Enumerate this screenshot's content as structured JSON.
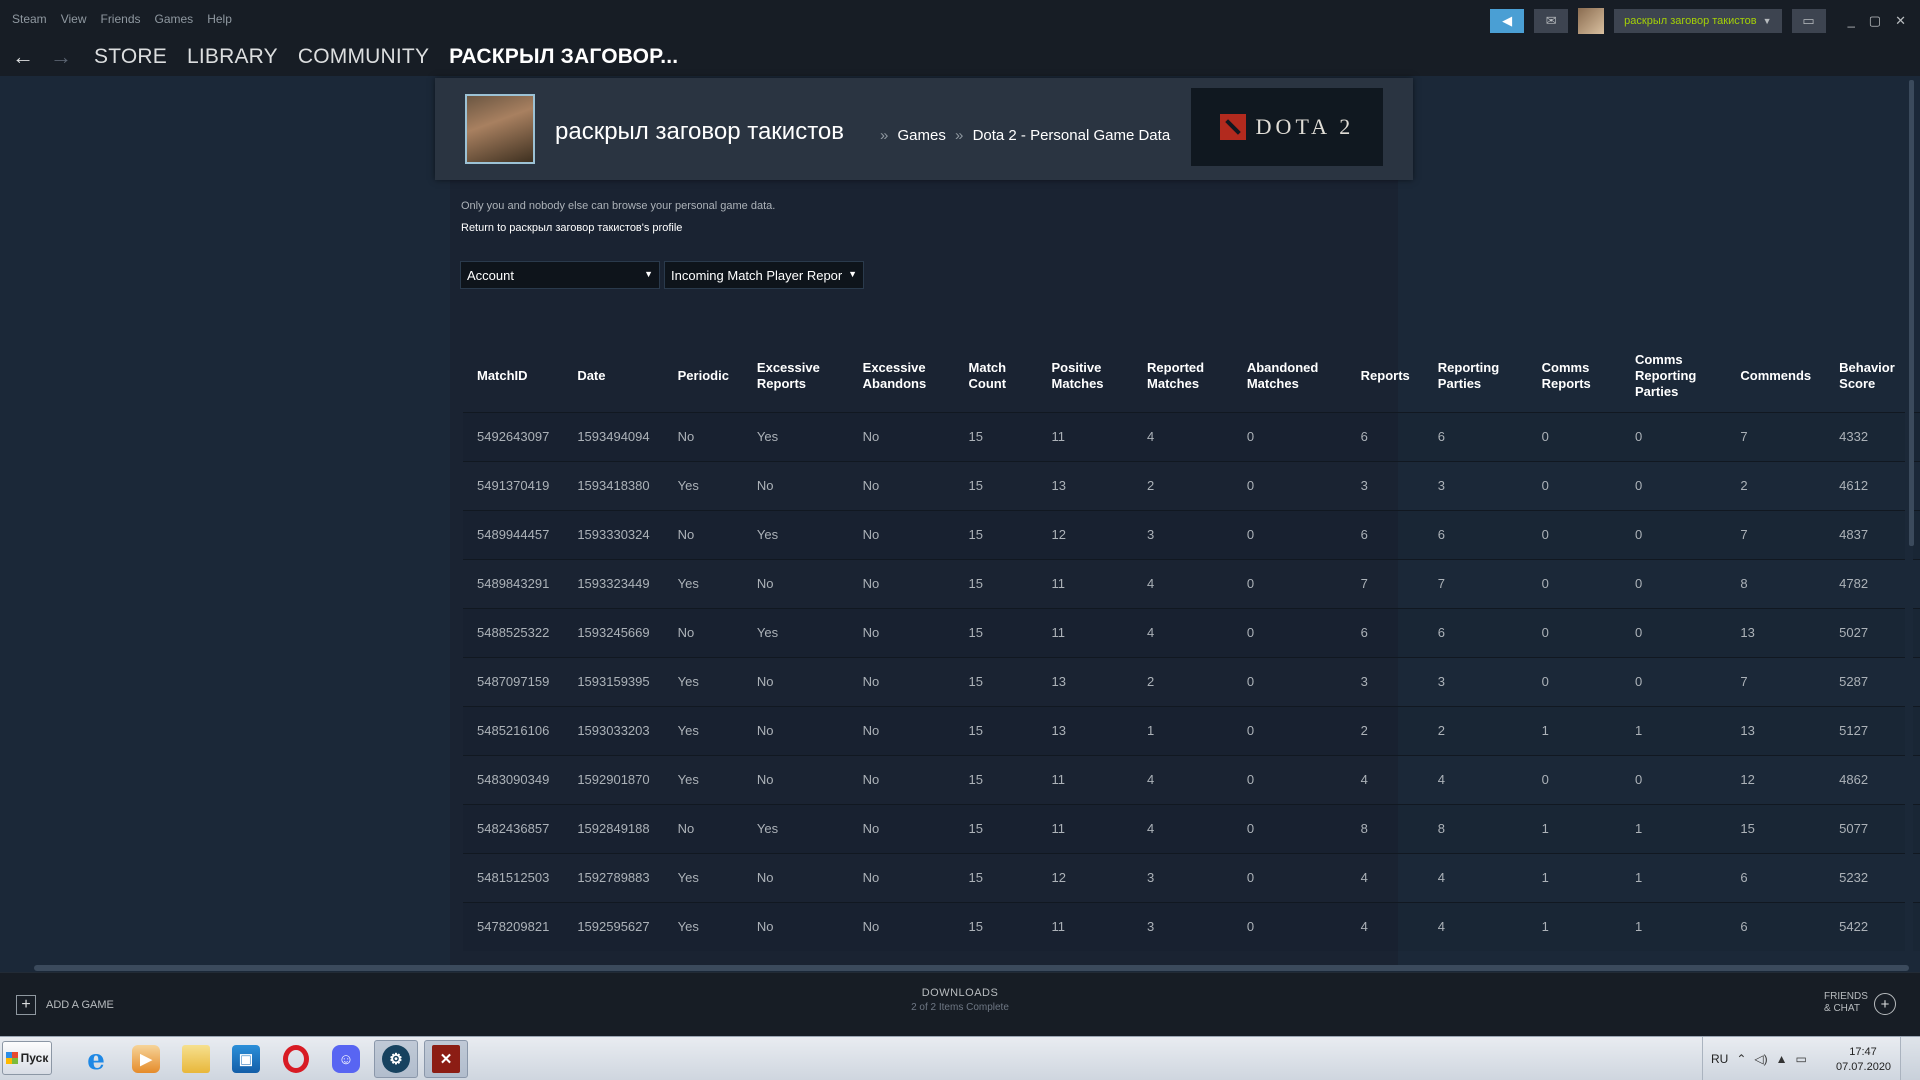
{
  "menu": [
    "Steam",
    "View",
    "Friends",
    "Games",
    "Help"
  ],
  "top_right": {
    "username": "раскрыл заговор такистов",
    "window_controls": [
      "_",
      "▢",
      "✕"
    ]
  },
  "nav": {
    "back": "←",
    "forward": "→",
    "links": [
      "STORE",
      "LIBRARY",
      "COMMUNITY"
    ],
    "active": "РАСКРЫЛ ЗАГОВОР..."
  },
  "profile": {
    "name": "раскрыл заговор такистов",
    "crumb_sep": "»",
    "crumb_games": "Games",
    "crumb_page": "Dota 2 - Personal Game Data",
    "game_logo_text": "DOTA 2"
  },
  "content": {
    "note": "Only you and nobody else can browse your personal game data.",
    "return_link": "Return to раскрыл заговор такистов's profile",
    "select_1": "Account",
    "select_2": "Incoming Match Player Repor",
    "dropdown_arrow": "▼"
  },
  "table": {
    "headers": [
      "MatchID",
      "Date",
      "Periodic",
      "Excessive Reports",
      "Excessive Abandons",
      "Match Count",
      "Positive Matches",
      "Reported Matches",
      "Abandoned Matches",
      "Reports",
      "Reporting Parties",
      "Comms Reports",
      "Comms Reporting Parties",
      "Commends",
      "Behavior Score"
    ],
    "rows": [
      [
        "5492643097",
        "1593494094",
        "No",
        "Yes",
        "No",
        "15",
        "11",
        "4",
        "0",
        "6",
        "6",
        "0",
        "0",
        "7",
        "4332"
      ],
      [
        "5491370419",
        "1593418380",
        "Yes",
        "No",
        "No",
        "15",
        "13",
        "2",
        "0",
        "3",
        "3",
        "0",
        "0",
        "2",
        "4612"
      ],
      [
        "5489944457",
        "1593330324",
        "No",
        "Yes",
        "No",
        "15",
        "12",
        "3",
        "0",
        "6",
        "6",
        "0",
        "0",
        "7",
        "4837"
      ],
      [
        "5489843291",
        "1593323449",
        "Yes",
        "No",
        "No",
        "15",
        "11",
        "4",
        "0",
        "7",
        "7",
        "0",
        "0",
        "8",
        "4782"
      ],
      [
        "5488525322",
        "1593245669",
        "No",
        "Yes",
        "No",
        "15",
        "11",
        "4",
        "0",
        "6",
        "6",
        "0",
        "0",
        "13",
        "5027"
      ],
      [
        "5487097159",
        "1593159395",
        "Yes",
        "No",
        "No",
        "15",
        "13",
        "2",
        "0",
        "3",
        "3",
        "0",
        "0",
        "7",
        "5287"
      ],
      [
        "5485216106",
        "1593033203",
        "Yes",
        "No",
        "No",
        "15",
        "13",
        "1",
        "0",
        "2",
        "2",
        "1",
        "1",
        "13",
        "5127"
      ],
      [
        "5483090349",
        "1592901870",
        "Yes",
        "No",
        "No",
        "15",
        "11",
        "4",
        "0",
        "4",
        "4",
        "0",
        "0",
        "12",
        "4862"
      ],
      [
        "5482436857",
        "1592849188",
        "No",
        "Yes",
        "No",
        "15",
        "11",
        "4",
        "0",
        "8",
        "8",
        "1",
        "1",
        "15",
        "5077"
      ],
      [
        "5481512503",
        "1592789883",
        "Yes",
        "No",
        "No",
        "15",
        "12",
        "3",
        "0",
        "4",
        "4",
        "1",
        "1",
        "6",
        "5232"
      ],
      [
        "5478209821",
        "1592595627",
        "Yes",
        "No",
        "No",
        "15",
        "11",
        "3",
        "0",
        "4",
        "4",
        "1",
        "1",
        "6",
        "5422"
      ]
    ]
  },
  "bottom": {
    "add_game": "ADD A GAME",
    "downloads_title": "DOWNLOADS",
    "downloads_status": "2 of 2 Items Complete",
    "friends_line1": "FRIENDS",
    "friends_line2": "& CHAT",
    "plus": "+"
  },
  "taskbar": {
    "start_label": "Пуск",
    "apps": [
      "internet-explorer-icon",
      "media-player-icon",
      "file-explorer-icon",
      "store-icon",
      "opera-icon",
      "discord-icon",
      "steam-icon",
      "dota2-icon"
    ],
    "lang": "RU",
    "time": "17:47",
    "date": "07.07.2020"
  },
  "colors": {
    "background": "#1b2838",
    "topbar": "#171d25",
    "accent_user": "#a4d007",
    "panel": "#1a2332"
  }
}
